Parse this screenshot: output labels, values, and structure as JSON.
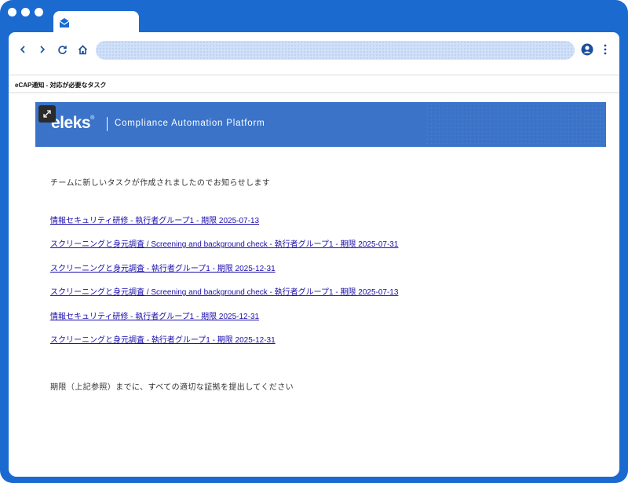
{
  "browser": {
    "page_title": "eCAP通知 - 対応が必要なタスク",
    "icons": [
      "envelope-icon",
      "back-icon",
      "forward-icon",
      "reload-icon",
      "home-icon",
      "profile-icon",
      "more-vert-icon"
    ]
  },
  "banner": {
    "logo": "eleks",
    "registered": "®",
    "tagline": "Compliance Automation Platform"
  },
  "email": {
    "intro": "チームに新しいタスクが作成されましたのでお知らせします",
    "tasks": [
      "情報セキュリティ研修 - 執行者グループ1 - 期限 2025-07-13",
      "スクリーニングと身元調査 / Screening and background check - 執行者グループ1 - 期限 2025-07-31",
      "スクリーニングと身元調査 - 執行者グループ1 - 期限 2025-12-31",
      "スクリーニングと身元調査 / Screening and background check - 執行者グループ1 - 期限 2025-07-13",
      "情報セキュリティ研修 - 執行者グループ1 - 期限 2025-12-31",
      "スクリーニングと身元調査 - 執行者グループ1 - 期限 2025-12-31"
    ],
    "outro": "期限（上記参照）までに、すべての適切な証拠を提出してください"
  },
  "colors": {
    "frame": "#1a6ad0",
    "banner": "#3a73c8",
    "link": "#1a0dab"
  }
}
